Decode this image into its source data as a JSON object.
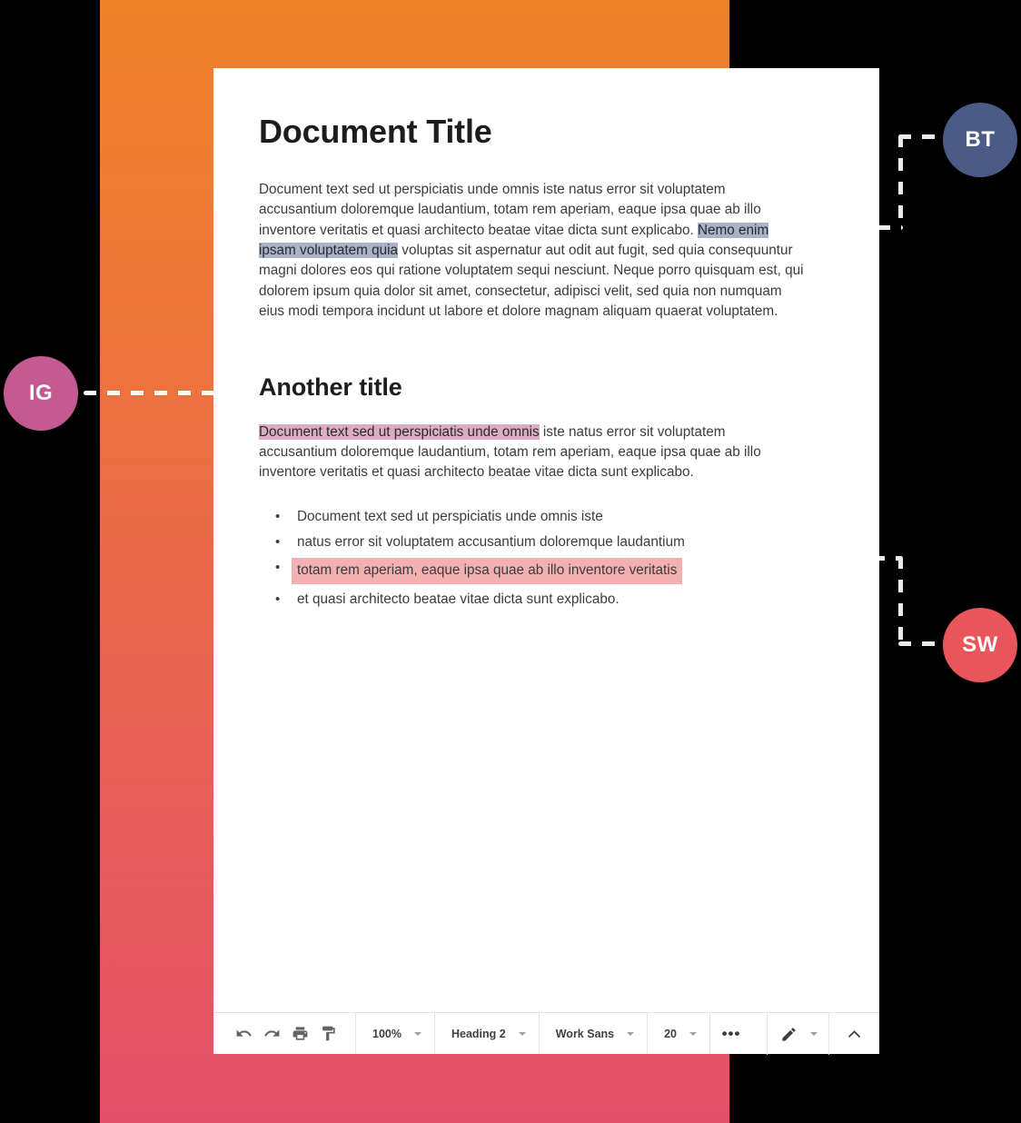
{
  "colors": {
    "gradient_start": "#ef8129",
    "gradient_end": "#e4506a",
    "avatar_bt": "#4b5b87",
    "avatar_ig": "#c45a92",
    "avatar_sw": "#e8565c",
    "highlight_gray": "#aab2c6",
    "highlight_mauve": "#ddacc4",
    "highlight_salmon": "#f2b0b0",
    "connector": "#eceaea"
  },
  "document": {
    "title": "Document Title",
    "paragraph1": {
      "before": "Document text sed ut perspiciatis unde omnis iste natus error sit voluptatem accusantium doloremque laudantium, totam rem aperiam, eaque ipsa quae ab illo inventore veritatis et quasi architecto beatae vitae dicta sunt explicabo. ",
      "highlight": "Nemo enim ipsam voluptatem quia",
      "after": " voluptas sit aspernatur aut odit aut fugit, sed quia consequuntur magni dolores eos qui ratione voluptatem sequi nesciunt. Neque porro quisquam est, qui dolorem ipsum quia dolor sit amet, consectetur, adipisci velit, sed quia non numquam eius modi tempora incidunt ut labore et dolore magnam aliquam quaerat voluptatem."
    },
    "subtitle": "Another title",
    "paragraph2": {
      "highlight": "Document text sed ut perspiciatis unde omnis",
      "after": " iste natus error sit voluptatem accusantium doloremque laudantium, totam rem aperiam, eaque ipsa quae ab illo inventore veritatis et quasi architecto beatae vitae dicta sunt explicabo."
    },
    "bullet_char": "•",
    "list": [
      {
        "text": "Document text sed ut perspiciatis unde omnis iste",
        "highlighted": false
      },
      {
        "text": "natus error sit voluptatem accusantium doloremque laudantium",
        "highlighted": false
      },
      {
        "text": "totam rem aperiam, eaque ipsa quae ab illo inventore veritatis",
        "highlighted": true
      },
      {
        "text": "et quasi architecto beatae vitae dicta sunt explicabo.",
        "highlighted": false
      }
    ]
  },
  "toolbar": {
    "undo_label": "Undo",
    "redo_label": "Redo",
    "print_label": "Print",
    "paint_format_label": "Paint format",
    "zoom_value": "100%",
    "style_value": "Heading 2",
    "font_value": "Work Sans",
    "size_value": "20",
    "more_label": "•••",
    "edit_mode_label": "Editing",
    "collapse_label": "Hide toolbar"
  },
  "collaborators": [
    {
      "initials": "BT",
      "color": "#4b5b87"
    },
    {
      "initials": "IG",
      "color": "#c45a92"
    },
    {
      "initials": "SW",
      "color": "#e8565c"
    }
  ]
}
